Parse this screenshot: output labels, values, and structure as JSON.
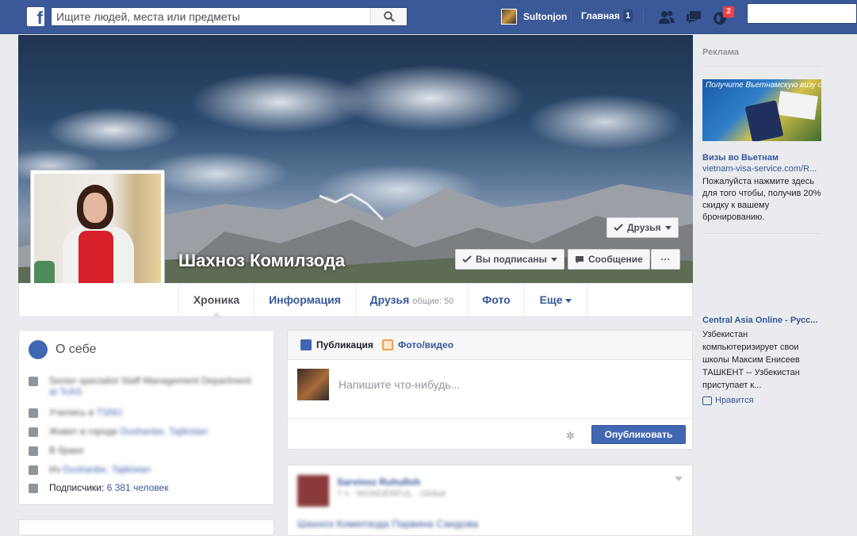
{
  "topbar": {
    "logo": "f",
    "search_placeholder": "Ищите людей, места или предметы",
    "user_name": "Sultonjon",
    "home_label": "Главная",
    "home_count": "1",
    "notifications_count": "2",
    "icons": [
      "friend-requests-icon",
      "messages-icon",
      "notifications-globe-icon",
      "search-icon"
    ]
  },
  "profile": {
    "name": "Шахноз Комилзода",
    "friends_button": "Друзья",
    "subscribed_button": "Вы подписаны",
    "message_button": "Сообщение",
    "more_button": "···"
  },
  "tabs": [
    {
      "label": "Хроника"
    },
    {
      "label": "Информация"
    },
    {
      "label": "Друзья",
      "sub": "общие: 50"
    },
    {
      "label": "Фото"
    },
    {
      "label": "Еще"
    }
  ],
  "about": {
    "title": "О себе",
    "rows": [
      {
        "text": "Senior specialist Staff Management Department",
        "extra": "at TcAS"
      },
      {
        "text": "Учились в",
        "extra": "TSNU"
      },
      {
        "text": "Живет в городе",
        "extra": "Dushanbe, Tajikistan"
      },
      {
        "text": "В браке",
        "extra": ""
      },
      {
        "text": "Из",
        "extra": "Dushanbe, Tajikistan"
      }
    ],
    "followers_label": "Подписчики:",
    "followers_value": "6 381 человек"
  },
  "composer": {
    "tab_post": "Публикация",
    "tab_photo": "Фото/видео",
    "placeholder": "Напишите что-нибудь...",
    "publish": "Опубликовать",
    "gear_glyph": "✲"
  },
  "post": {
    "author": "Sarvinoz Ruhulloh",
    "meta": "7 ч · WONDERFUL · Global",
    "text": "Шахноз Комилзода Парвина Саидова"
  },
  "ads": {
    "title": "Реклама",
    "ad1": {
      "image_text": "Получите Вьетнамскую визу онлайн",
      "headline": "Визы во Вьетнам",
      "url": "vietnam-visa-service.com/R...",
      "body": "Пожалуйста нажмите здесь для того чтобы, получив 20% скидку к вашему бронированию."
    },
    "ad2": {
      "headline": "Central Asia Online - Русс...",
      "body": "Узбекистан компьютеризирует свои школы Максим Енисеев ТАШКЕНТ -- Узбекистан приступает к...",
      "like": "Нравится"
    }
  },
  "colors": {
    "topbar": "#3b5998",
    "link": "#365899",
    "button_primary": "#4267b2",
    "badge": "#fa3e3e"
  }
}
